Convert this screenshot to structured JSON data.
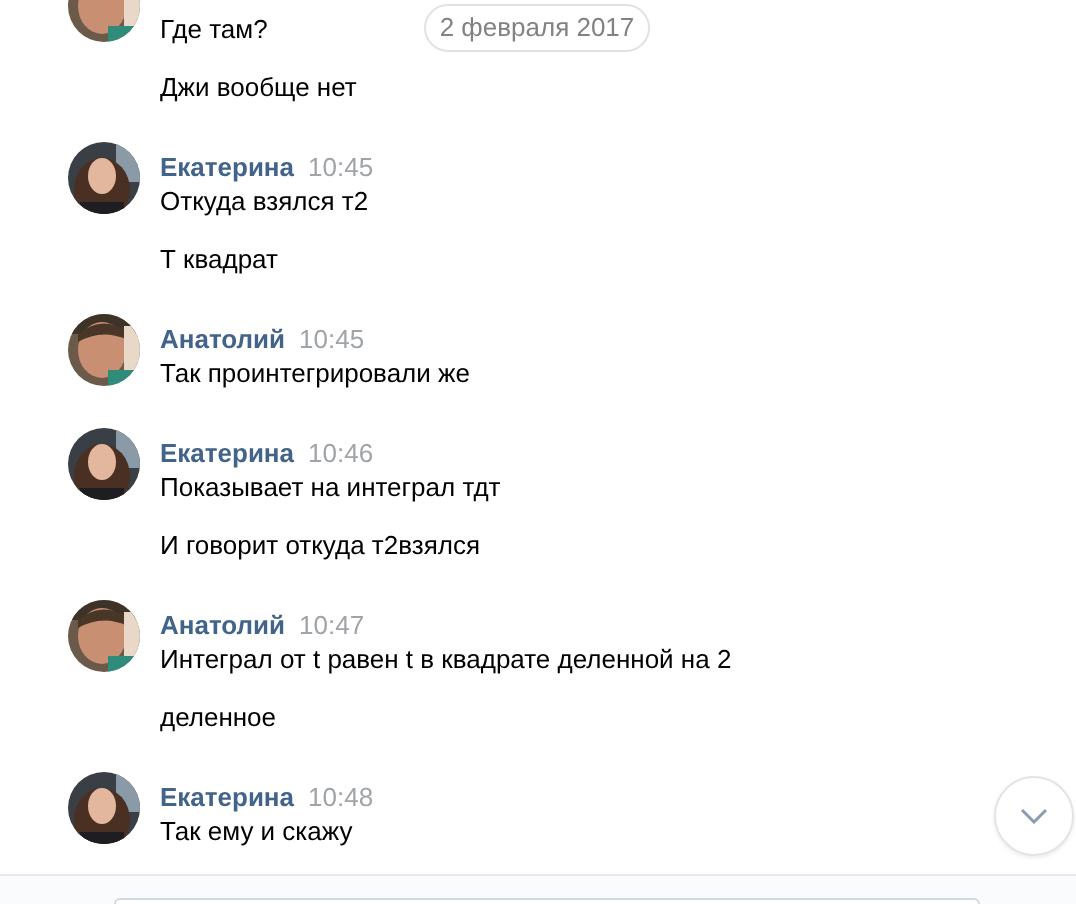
{
  "date_badge": "2 февраля 2017",
  "groups": [
    {
      "messages": [
        "Где там?",
        "Джи вообще нет"
      ]
    },
    {
      "author": "Екатерина",
      "time": "10:45",
      "messages": [
        "Откуда взялся т2",
        "Т квадрат"
      ]
    },
    {
      "author": "Анатолий",
      "time": "10:45",
      "messages": [
        "Так проинтегрировали же"
      ]
    },
    {
      "author": "Екатерина",
      "time": "10:46",
      "messages": [
        "Показывает на интеграл тдт",
        "И говорит откуда т2взялся"
      ]
    },
    {
      "author": "Анатолий",
      "time": "10:47",
      "messages": [
        "Интеграл от t равен t в квадрате деленной на 2",
        "деленное"
      ]
    },
    {
      "author": "Екатерина",
      "time": "10:48",
      "messages": [
        "Так ему и скажу"
      ]
    }
  ]
}
